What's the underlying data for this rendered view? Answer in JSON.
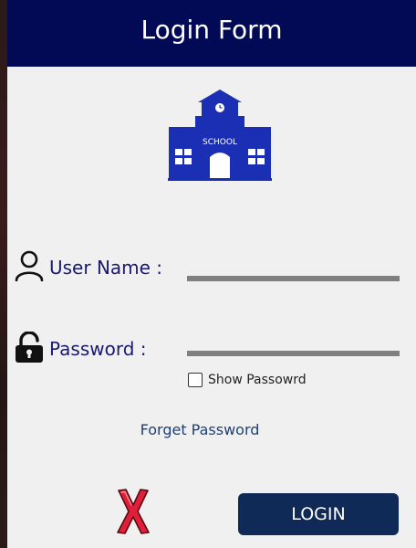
{
  "window": {
    "title": "Login Form"
  },
  "logo": {
    "icon": "school-building-icon",
    "text": "SCHOOL",
    "color": "#1a2fb3"
  },
  "form": {
    "username": {
      "label": "User Name :",
      "icon": "user-icon",
      "value": ""
    },
    "password": {
      "label": "Password :",
      "icon": "lock-icon",
      "value": ""
    },
    "show_password": {
      "label": "Show Passowrd",
      "checked": false
    },
    "forget_password_label": "Forget Password"
  },
  "actions": {
    "close_icon": "red-x-icon",
    "login_label": "LOGIN"
  },
  "colors": {
    "header_bg": "#020a55",
    "login_button_bg": "#0f2a57",
    "label_color": "#1a1a6e",
    "close_color": "#e0203a"
  }
}
